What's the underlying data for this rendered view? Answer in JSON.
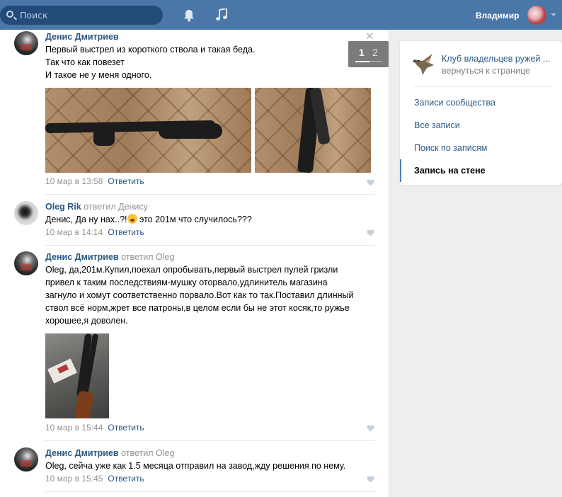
{
  "header": {
    "search_placeholder": "Поиск",
    "user_name": "Владимир",
    "icons": [
      "search-icon",
      "bell-icon",
      "music-icon"
    ],
    "brand_color": "#4a76a8"
  },
  "viewer": {
    "close_symbol": "✕",
    "pager": {
      "current": "1",
      "next": "2"
    }
  },
  "posts": [
    {
      "author": "Денис Дмитриев",
      "lines": [
        "Первый выстрел из короткого ствола и такая беда.",
        "Так что как повезет",
        "И такое не у меня одного."
      ],
      "date": "10 мар в 13:58",
      "reply": "Ответить"
    },
    {
      "author": "Oleg Rik",
      "replied": "ответил Денису",
      "text_before": "Денис, Да ну нах..?!",
      "text_after": " это 201м что случилось???",
      "date": "10 мар в 14:14",
      "reply": "Ответить"
    },
    {
      "author": "Денис Дмитриев",
      "replied": "ответил Oleg",
      "lines": [
        "Oleg, да,201м.Купил,поехал опробывать,первый выстрел пулей гризли",
        "привел к таким последствиям-мушку оторвало,удлинитель магазина",
        "загнуло и хомут соответственно порвало.Вот как то так.Поставил длинный",
        "ствол всё норм,жрет все патроны,в целом если бы не этот косяк,то ружье",
        "хорошее,я доволен."
      ],
      "date": "10 мар в 15:44",
      "reply": "Ответить"
    },
    {
      "author": "Денис Дмитриев",
      "replied": "ответил Oleg",
      "lines": [
        "Oleg, сейча уже как 1.5 месяца отправил на завод,жду решения по нему."
      ],
      "date": "10 мар в 15:45",
      "reply": "Ответить"
    }
  ],
  "sidebar": {
    "group_name": "Клуб владельцев ружей ...",
    "back": "вернуться к странице",
    "items": [
      {
        "label": "Записи сообщества",
        "active": false
      },
      {
        "label": "Все записи",
        "active": false
      },
      {
        "label": "Поиск по записям",
        "active": false
      },
      {
        "label": "Запись на стене",
        "active": true
      }
    ]
  }
}
